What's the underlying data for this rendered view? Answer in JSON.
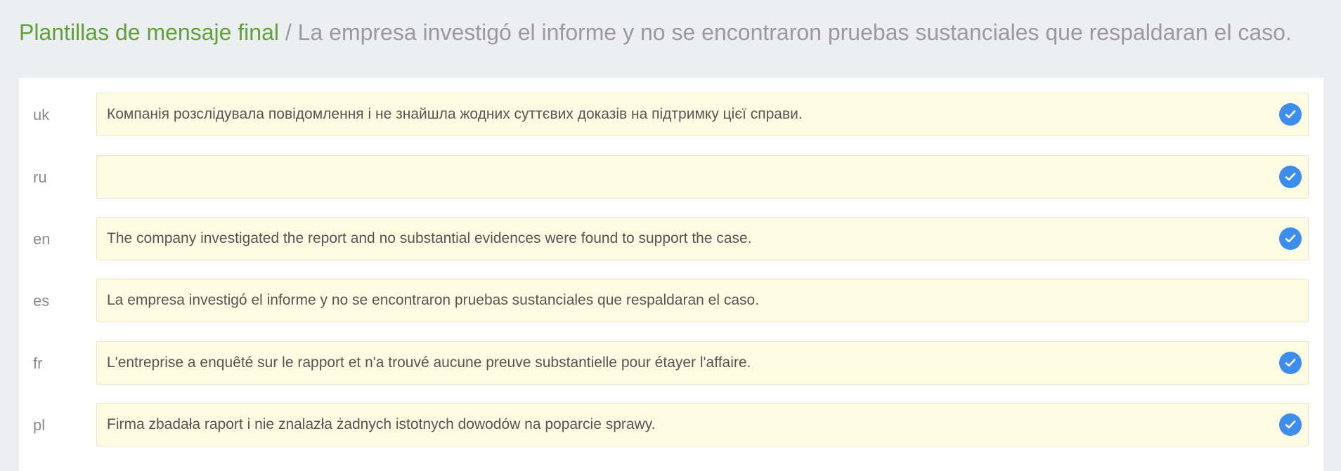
{
  "header": {
    "link_label": "Plantillas de mensaje final",
    "separator": " / ",
    "current_title": "La empresa investigó el informe y no se encontraron pruebas sustanciales que respaldaran el caso."
  },
  "translations": [
    {
      "lang": "uk",
      "text": "Компанія розслідувала повідомлення і не знайшла жодних суттєвих доказів на підтримку цієї справи.",
      "confirmed": true
    },
    {
      "lang": "ru",
      "text": "",
      "confirmed": true
    },
    {
      "lang": "en",
      "text": "The company investigated the report and no substantial evidences were found to support the case.",
      "confirmed": true
    },
    {
      "lang": "es",
      "text": "La empresa investigó el informe y no se encontraron pruebas sustanciales que respaldaran el caso.",
      "confirmed": false
    },
    {
      "lang": "fr",
      "text": "L'entreprise a enquêté sur le rapport et n'a trouvé aucune preuve substantielle pour étayer l'affaire.",
      "confirmed": true
    },
    {
      "lang": "pl",
      "text": "Firma zbadała raport i nie znalazła żadnych istotnych dowodów na poparcie sprawy.",
      "confirmed": true
    }
  ],
  "colors": {
    "accent_green": "#5fa03a",
    "check_blue": "#3d8ded",
    "field_bg": "#fdfce2"
  },
  "icons": {
    "confirmed": "checkmark-circle-icon"
  }
}
